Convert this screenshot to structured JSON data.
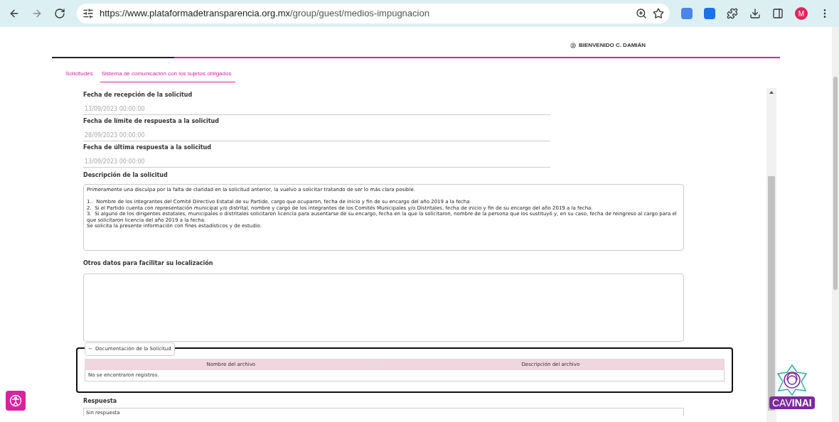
{
  "browser": {
    "url_host": "https://www.plataformadetransparencia.org.mx",
    "url_path": "/group/guest/medios-impugnacion",
    "profile_initial": "M"
  },
  "header": {
    "welcome": "BIENVENIDO C. DAMIÁN"
  },
  "tabs": [
    {
      "label": "Solicitudes",
      "selected": false
    },
    {
      "label": "Sistema de comunicación con los sujetos obligados",
      "selected": true
    }
  ],
  "fields": [
    {
      "label": "Fecha de recepción de la solicitud",
      "value": "13/09/2023 00:00:00",
      "disabled": true
    },
    {
      "label": "Fecha de límite de respuesta a la solicitud",
      "value": "28/09/2023 00:00:00",
      "disabled": true
    },
    {
      "label": "Fecha de última respuesta a la solicitud",
      "value": "13/09/2023 00:00:00",
      "disabled": true
    }
  ],
  "description": {
    "label": "Descripción de la solicitud",
    "lines": [
      "Primeramente una disculpa por la falta de claridad en la solicitud anterior, la vuelvo a solicitar tratando de ser lo más clara posible.",
      "1..  Nombre de los integrantes del Comité Directivo Estatal de su Partido, cargo que ocuparon, fecha de inicio y fin de su encargo del año 2019 a la fecha",
      "2.  Si el Partido cuenta con representación municipal y/o distrital, nombre y cargo de los integrantes de los Comités Municipales y/o Distritales, fecha de inicio y fin de su encargo del año 2019 a la fecha.",
      "3.  Si alguno de los dirigentes estatales, municipales o distritales solicitaron licencia para ausentarse de su encargo, fecha en la que la solicitaron, nombre de la persona que los sustituyó y, en su caso, fecha de reingreso al cargo para el que solicitaron licencia del año 2019 a la fecha.",
      "Se solicita la presente información con fines estadísticos y de estudio."
    ]
  },
  "other": {
    "label": "Otros datos para facilitar su localización"
  },
  "documents": {
    "legend": "Documentación de la Solicitud",
    "toggle": "−",
    "expanded": true,
    "columns": [
      "Nombre del archivo",
      "Descripción del archivo"
    ],
    "empty": "No se encontraron registros."
  },
  "response": {
    "label": "Respuesta",
    "value": "Sin respuesta"
  },
  "chat_logo": {
    "text_light": "CAV",
    "text_bold": "INAI"
  }
}
